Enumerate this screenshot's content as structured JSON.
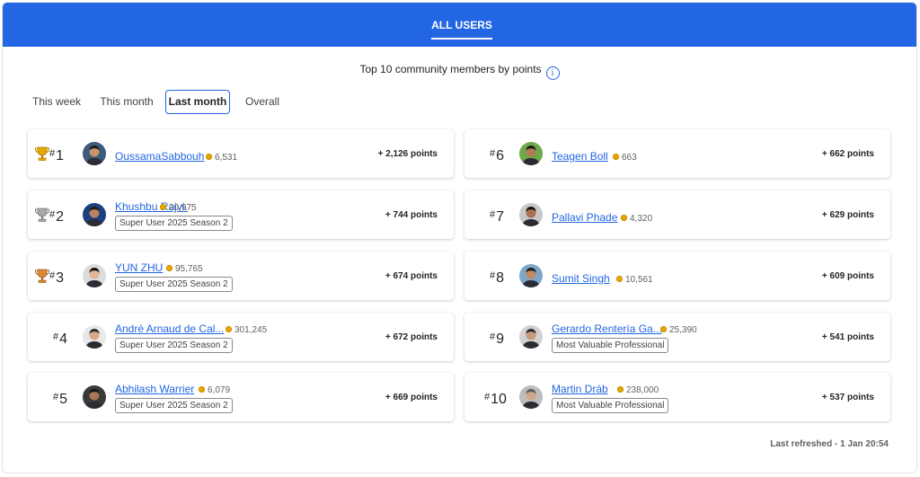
{
  "header": {
    "tab_label": "ALL USERS"
  },
  "subtitle": "Top 10 community members by points",
  "info_icon": "info-icon",
  "periods": [
    "This week",
    "This month",
    "Last month",
    "Overall"
  ],
  "active_period": "Last month",
  "colors": {
    "accent": "#2266e3",
    "gold": "#e8a700",
    "silver": "#a8a8a8",
    "bronze": "#d9893a"
  },
  "leaderboard": [
    {
      "rank": "1",
      "name": "OussamaSabbouh",
      "score": "6,531",
      "badge": "",
      "points": "+ 2,126 points",
      "trophy": "gold"
    },
    {
      "rank": "2",
      "name": "Khushbu Rajvi.",
      "score": "20,975",
      "badge": "Super User 2025 Season 2",
      "points": "+ 744 points",
      "trophy": "silver"
    },
    {
      "rank": "3",
      "name": "YUN ZHU",
      "score": "95,765",
      "badge": "Super User 2025 Season 2",
      "points": "+ 674 points",
      "trophy": "bronze"
    },
    {
      "rank": "4",
      "name": "André Arnaud de Cal...",
      "score": "301,245",
      "badge": "Super User 2025 Season 2",
      "points": "+ 672 points",
      "trophy": ""
    },
    {
      "rank": "5",
      "name": "Abhilash Warrier",
      "score": "6,079",
      "badge": "Super User 2025 Season 2",
      "points": "+ 669 points",
      "trophy": ""
    },
    {
      "rank": "6",
      "name": "Teagen Boll",
      "score": "663",
      "badge": "",
      "points": "+ 662 points",
      "trophy": ""
    },
    {
      "rank": "7",
      "name": "Pallavi Phade",
      "score": "4,320",
      "badge": "",
      "points": "+ 629 points",
      "trophy": ""
    },
    {
      "rank": "8",
      "name": "Sumit Singh",
      "score": "10,561",
      "badge": "",
      "points": "+ 609 points",
      "trophy": ""
    },
    {
      "rank": "9",
      "name": "Gerardo Rentería Ga...",
      "score": "25,390",
      "badge": "Most Valuable Professional",
      "points": "+ 541 points",
      "trophy": ""
    },
    {
      "rank": "10",
      "name": "Martin Dráb",
      "score": "238,000",
      "badge": "Most Valuable Professional",
      "points": "+ 537 points",
      "trophy": ""
    }
  ],
  "rank_prefix": "#",
  "last_refreshed": "Last refreshed - 1 Jan 20:54"
}
